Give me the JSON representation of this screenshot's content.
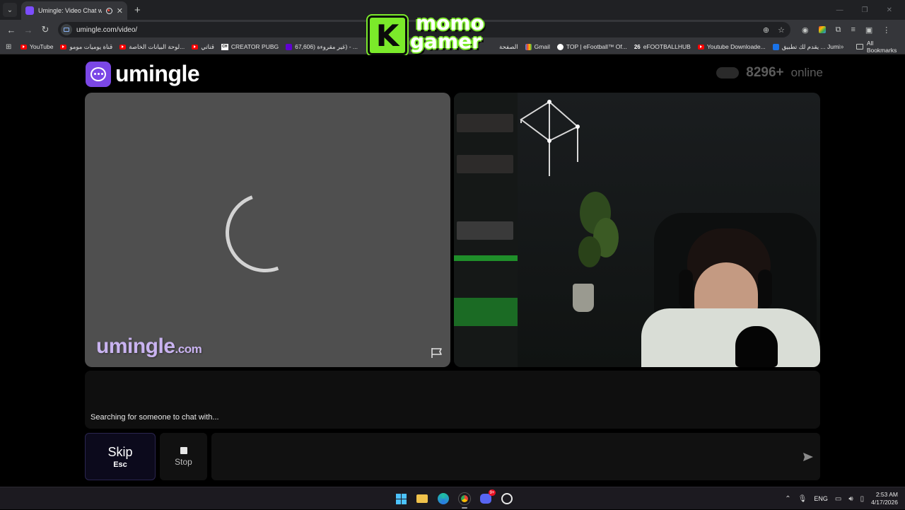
{
  "browser": {
    "tab_title": "Umingle: Video Chat with S",
    "new_tab_symbol": "+",
    "url": "umingle.com/video/",
    "bookmarks": [
      {
        "label": "YouTube",
        "icon": "youtube-icon"
      },
      {
        "label": "قناة يوميات مومو",
        "icon": "youtube-icon"
      },
      {
        "label": "لوحة البيانات الخاصة...",
        "icon": "youtube-icon"
      },
      {
        "label": "قناتي",
        "icon": "youtube-icon"
      },
      {
        "label": "CREATOR PUBG",
        "icon": "ch-icon"
      },
      {
        "label": "67,606) غير مقروءة) - ...",
        "icon": "yahoo-icon"
      },
      {
        "label": "الصفحة",
        "icon": "youtube-icon"
      },
      {
        "label": "Gmail",
        "icon": "gmail-icon"
      },
      {
        "label": "TOP | eFootball™ Of...",
        "icon": "efootball-icon"
      },
      {
        "label": "eFOOTBALLHUB",
        "icon": "hub-26-icon"
      },
      {
        "label": "Youtube Downloade...",
        "icon": "youtube-icon"
      },
      {
        "label": "يقدم لك تطبيق ... Jumi",
        "icon": "jumia-icon"
      }
    ],
    "all_bookmarks_label": "All Bookmarks"
  },
  "overlay": {
    "logo_line1": "momo",
    "logo_line2": "gamer",
    "logo_letter": "K"
  },
  "site": {
    "brand": "umingle",
    "online_count": "8296+",
    "online_label": "online",
    "watermark_main": "umingle",
    "watermark_suffix": ".com",
    "status": "Searching for someone to chat with...",
    "skip_label": "Skip",
    "skip_key": "Esc",
    "stop_label": "Stop",
    "message_placeholder": "",
    "accent_color": "#7b47e6"
  },
  "taskbar": {
    "language": "ENG",
    "time": "2:53 AM",
    "date": "4/17/2026",
    "discord_badge": "9+",
    "icons": [
      "windows-start-icon",
      "file-explorer-icon",
      "edge-icon",
      "chrome-icon",
      "discord-icon",
      "github-icon"
    ]
  }
}
